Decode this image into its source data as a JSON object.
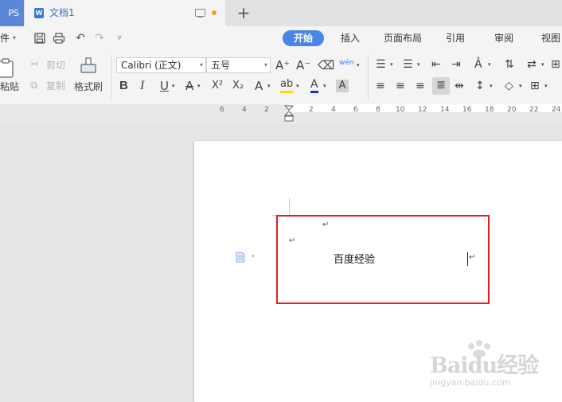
{
  "tabs": {
    "app_label": "PS",
    "doc_icon_letter": "W",
    "doc_title": "文档1",
    "add_tab": "+"
  },
  "menu": {
    "file_label": "件",
    "items": [
      "开始",
      "插入",
      "页面布局",
      "引用",
      "审阅",
      "视图"
    ],
    "active": "开始"
  },
  "toolbar": {
    "paste_label": "粘贴",
    "cut_label": "剪切",
    "copy_label": "复制",
    "format_painter_label": "格式刷",
    "font_name": "Calibri (正文)",
    "font_size": "五号",
    "pinyin_label": "wén",
    "bold": "B",
    "italic": "I",
    "underline": "U",
    "strikethrough": "A",
    "superscript": "X²",
    "subscript": "X₂",
    "text_effect": "A",
    "highlight": "ab",
    "font_color": "A",
    "char_shading": "A",
    "grow_font": "A⁺",
    "shrink_font": "A⁻"
  },
  "ruler": {
    "ticks": [
      "6",
      "4",
      "2",
      "2",
      "4",
      "6",
      "8",
      "10",
      "12",
      "14",
      "16",
      "18",
      "20",
      "22",
      "24"
    ]
  },
  "document": {
    "return_mark": "↵",
    "body_text": "百度经验",
    "cursor_mark": "↵"
  },
  "watermark": {
    "brand": "Baidu经验",
    "url": "jingyan.baidu.com"
  },
  "colors": {
    "accent": "#4a86e8",
    "highlight_box": "#e02020",
    "tab_active_text": "#3a6fc4",
    "unsaved_dot": "#f0a030"
  }
}
